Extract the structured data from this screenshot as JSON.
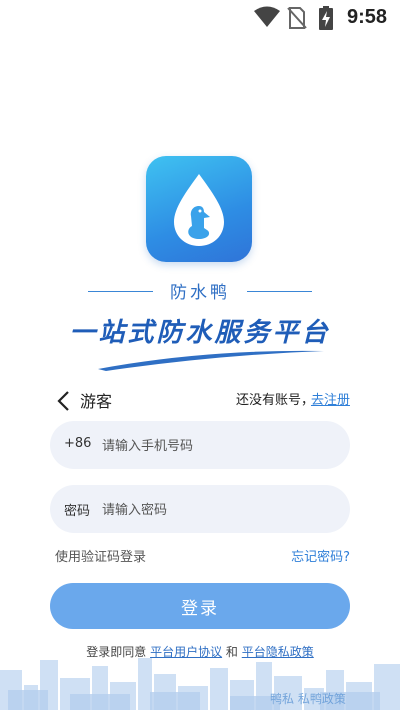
{
  "status_bar": {
    "time": "9:58",
    "icons": [
      "wifi-icon",
      "no-sim-icon",
      "battery-charging-icon"
    ]
  },
  "app": {
    "name": "防水鸭",
    "slogan": "一站式防水服务平台",
    "icon": "duck-water-drop-logo",
    "brand_color": "#2f74d8"
  },
  "nav": {
    "back_icon": "chevron-left-icon",
    "title": "游客",
    "no_account_text": "还没有账号，",
    "register_label": "去注册"
  },
  "form": {
    "phone_prefix": "+86",
    "phone_placeholder": "请输入手机号码",
    "password_prefix": "密码",
    "password_placeholder": "请输入密码",
    "code_login_label": "使用验证码登录",
    "forgot_label": "忘记密码?",
    "login_label": "登录"
  },
  "agreement": {
    "prefix": "登录即同意",
    "user_agreement": "平台用户协议",
    "and": "和",
    "privacy_policy": "平台隐私政策"
  },
  "background_overlap_text": "鸭私 私鸭政策",
  "colors": {
    "accent": "#2f7fd8",
    "button": "#6aa8ec",
    "input_bg": "#eff2f9"
  }
}
